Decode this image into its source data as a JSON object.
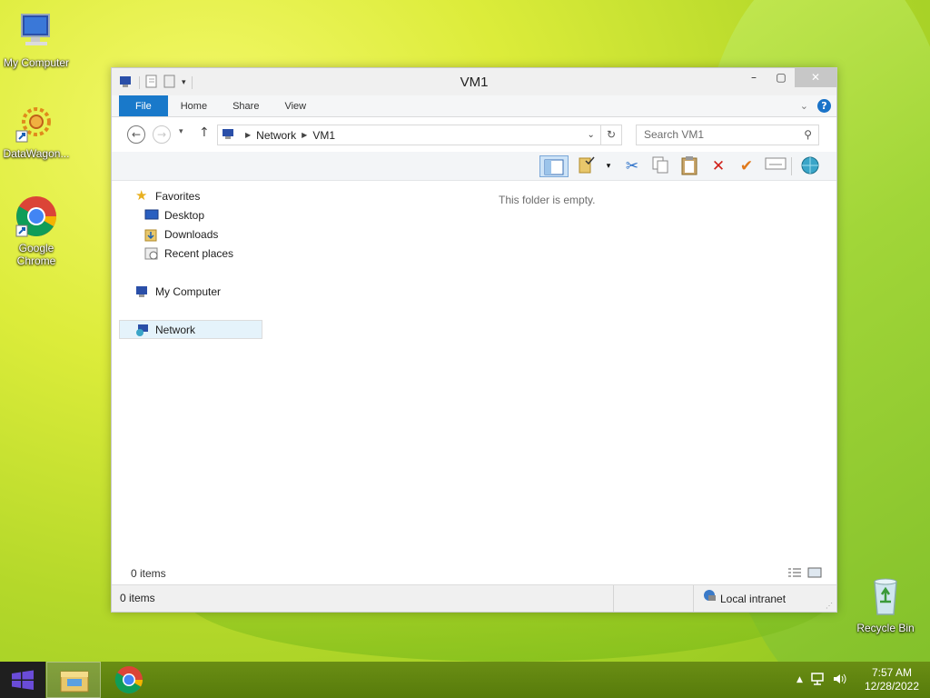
{
  "desktop": {
    "icons": [
      {
        "label": "My Computer"
      },
      {
        "label": "DataWagon..."
      },
      {
        "label": "Google Chrome"
      },
      {
        "label": "Recycle Bin"
      }
    ]
  },
  "window": {
    "title": "VM1",
    "ribbon_tabs": [
      "File",
      "Home",
      "Share",
      "View"
    ],
    "address_path": [
      "Network",
      "VM1"
    ],
    "search_placeholder": "Search VM1",
    "empty_message": "This folder is empty.",
    "nav": {
      "favorites": "Favorites",
      "desktop": "Desktop",
      "downloads": "Downloads",
      "recent": "Recent places",
      "my_computer": "My Computer",
      "network": "Network"
    },
    "item_count": "0 items",
    "status_items": "0 items",
    "status_zone": "Local intranet"
  },
  "taskbar": {
    "time": "7:57 AM",
    "date": "12/28/2022"
  },
  "colors": {
    "accent": "#1979ca",
    "taskbar": "#5f830e",
    "selection": "#e5f3fb"
  }
}
